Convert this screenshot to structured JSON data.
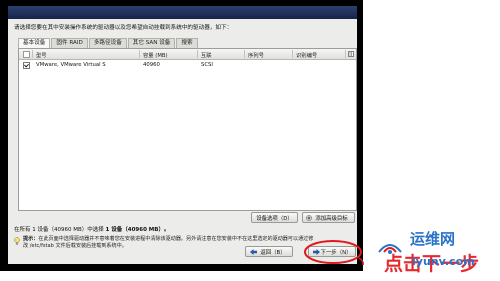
{
  "installer": {
    "prompt": "请选择您要在其中安装操作系统的驱动器以及您希望自动挂载到系统中的驱动器，如下：",
    "tabs": [
      {
        "label": "基本设备",
        "active": true
      },
      {
        "label": "固件 RAID",
        "active": false
      },
      {
        "label": "多路径设备",
        "active": false
      },
      {
        "label": "其它 SAN 设备",
        "active": false
      },
      {
        "label": "搜索",
        "active": false
      }
    ],
    "table": {
      "headers": [
        "型号",
        "容量 (MB)",
        "互联",
        "序列号",
        "识别编号"
      ],
      "rows": [
        {
          "checked": true,
          "model": "VMware, VMware Virtual S",
          "capacity": "40960",
          "interconnect": "SCSI",
          "serial": "",
          "identifier": ""
        }
      ]
    },
    "buttons": {
      "device_options": "设备选项（D）",
      "add_advanced": "添加高级目标",
      "back": "返回（B）",
      "next": "下一步（N）"
    },
    "summary": {
      "text": "在所有 1 设备（40960 MB）中选择",
      "selected": "1 设备（40960 MB）。"
    },
    "tip": {
      "prefix": "提示：",
      "text": "在此页面中选择驱动器并不意味着您在安装进程中清除该驱动器。另外请注意在您安装中不在这里选定的驱动器可以通过修改 /etc/fstab 文件后载安装后挂载到系统中。"
    }
  },
  "watermark": {
    "brand": "运维网",
    "click_text": "点击下一步",
    "domain": "iyunv.com"
  },
  "colors": {
    "banner": "#1f2f5a",
    "annotation_red": "#e0191c",
    "watermark_blue": "#2a73c9",
    "watermark_red": "#e4171b"
  }
}
